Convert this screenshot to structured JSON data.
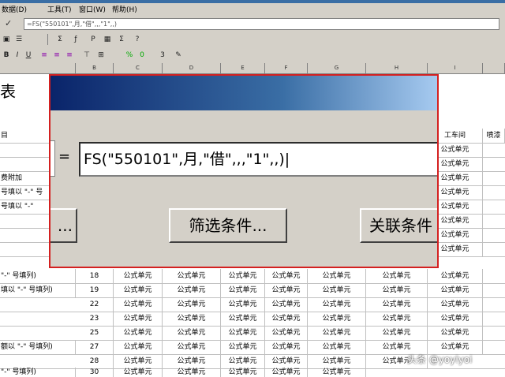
{
  "menu": [
    "数据(D)",
    "工具(T)",
    "窗口(W)",
    "帮助(H)"
  ],
  "formula_bar": {
    "value": "=FS(\"550101\",月,\"借\",,,\"1\",,)"
  },
  "toolbar1": [
    "Σ",
    "ƒ",
    "P",
    "Σ"
  ],
  "toolbar2": [
    "B",
    "I",
    "U",
    "%",
    "0",
    "3"
  ],
  "columns": [
    "B",
    "C",
    "D",
    "E",
    "F",
    "G",
    "H",
    "I"
  ],
  "sheet_title": "表",
  "left_labels": [
    "目",
    "费附加",
    "号填以 \"-\" 号",
    "号填以 \"-\"",
    "\"-\" 号填列)",
    "填以 \"-\" 号填列)",
    "额以 \"-\" 号填列)",
    "\"-\" 号填列)"
  ],
  "header_cells": {
    "workshop": "工车间",
    "spray": "喷漆"
  },
  "cell_value": "公式单元",
  "row_numbers": [
    "18",
    "19",
    "22",
    "23",
    "25",
    "27",
    "28",
    "30"
  ],
  "dialog": {
    "input_value": "FS(\"550101\",月,\"借\",,,\"1\",,)|",
    "equals": "=",
    "btn_left": "...",
    "btn_filter": "筛选条件...",
    "btn_relate": "关联条件"
  },
  "watermark": "头条 @yoyiyoi"
}
